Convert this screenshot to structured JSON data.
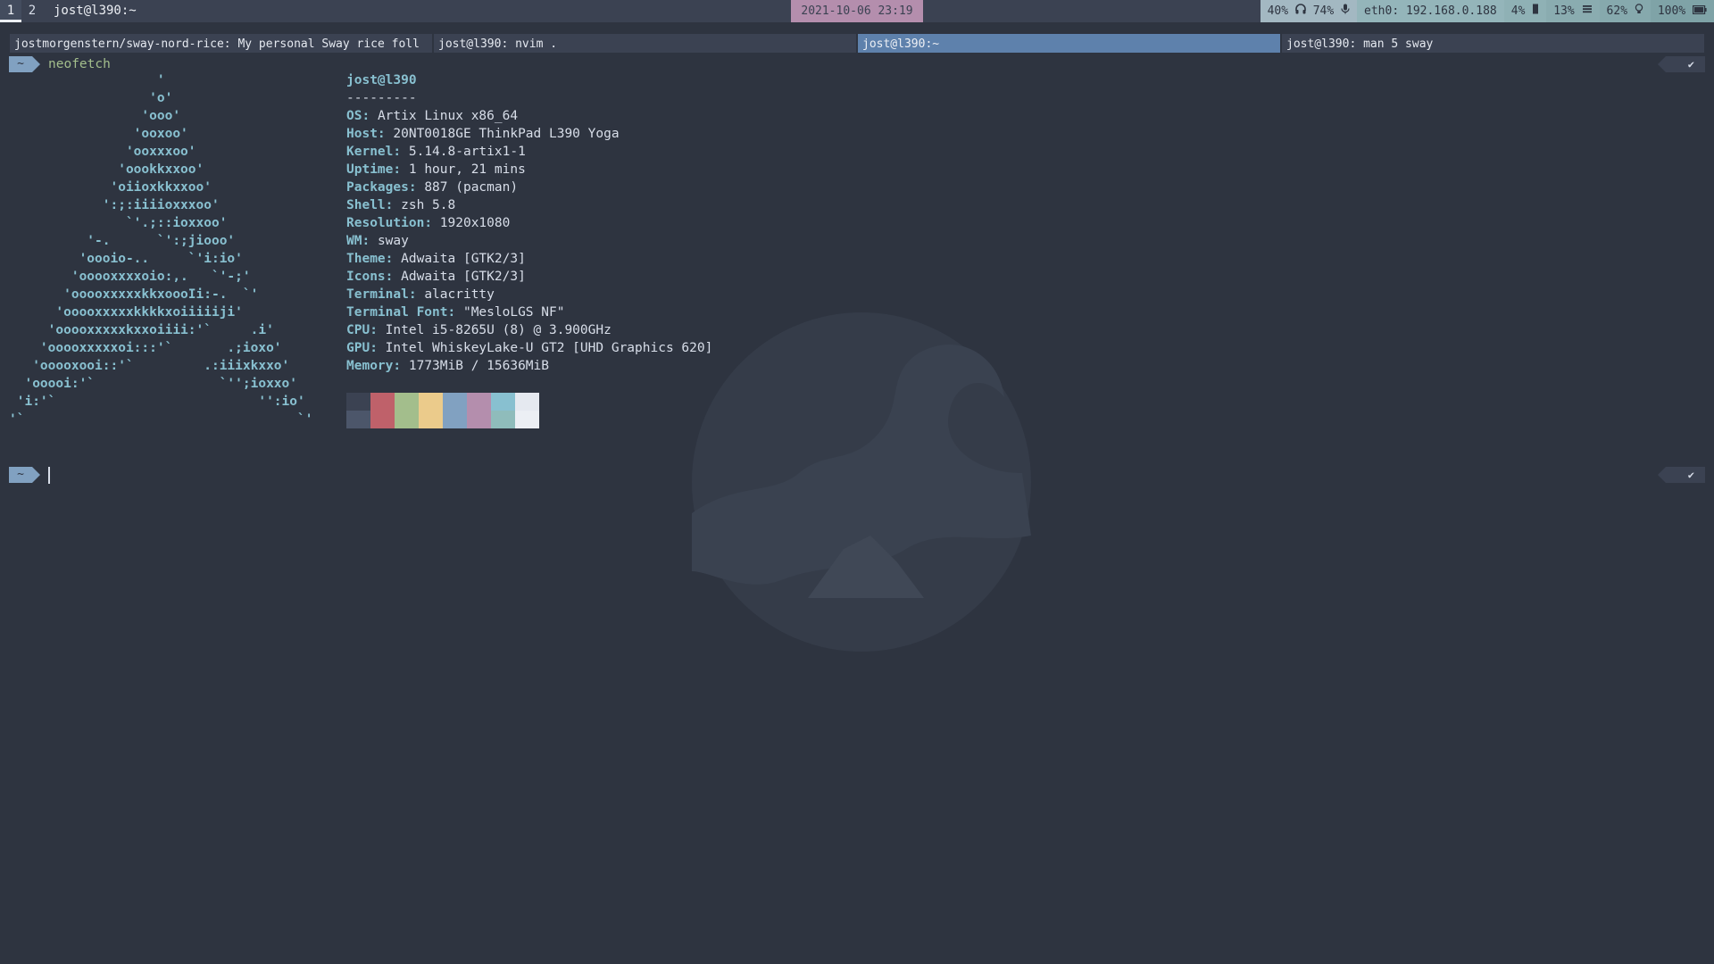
{
  "bar": {
    "workspaces": [
      {
        "label": "1",
        "active": true
      },
      {
        "label": "2",
        "active": false
      }
    ],
    "window_title": "jost@l390:~",
    "clock": "2021-10-06 23:19",
    "audio": "40%",
    "headphone": "74%",
    "network": "eth0: 192.168.0.188",
    "cpu": "4%",
    "memory": "13%",
    "brightness": "62%",
    "battery": "100%"
  },
  "tabs": [
    {
      "label": "jostmorgenstern/sway-nord-rice: My personal Sway rice foll",
      "focused": false
    },
    {
      "label": "jost@l390: nvim .",
      "focused": false
    },
    {
      "label": "jost@l390:~",
      "focused": true
    },
    {
      "label": "jost@l390: man 5 sway",
      "focused": false
    }
  ],
  "terminal": {
    "prompt_dir": "~",
    "command": "neofetch",
    "rprompt": "✔",
    "ascii_logo": "                   '\n                  'o'\n                 'ooo'\n                'ooxoo'\n               'ooxxxoo'\n              'oookkxxoo'\n             'oiioxkkxxoo'\n            ':;:iiiioxxxoo'\n               `'.;::ioxxoo'\n          '-.      `':;jiooo'\n         'oooio-..     `'i:io'\n        'ooooxxxxoio:,.   `'-;'\n       'ooooxxxxxkkxoooIi:-.  `'\n      'ooooxxxxxkkkkxoiiiiiji'\n     'ooooxxxxxkxxoiiii:'`     .i'\n    'ooooxxxxxoi:::'`       .;ioxo'\n   'ooooxooi::'`         .:iiixkxxo'\n  'ooooi:'`                `'';ioxxo'\n 'i:'`                          '':io'\n'`                                   `'",
    "user_host": "jost@l390",
    "separator": "---------",
    "info": [
      {
        "key": "OS",
        "value": "Artix Linux x86_64"
      },
      {
        "key": "Host",
        "value": "20NT0018GE ThinkPad L390 Yoga"
      },
      {
        "key": "Kernel",
        "value": "5.14.8-artix1-1"
      },
      {
        "key": "Uptime",
        "value": "1 hour, 21 mins"
      },
      {
        "key": "Packages",
        "value": "887 (pacman)"
      },
      {
        "key": "Shell",
        "value": "zsh 5.8"
      },
      {
        "key": "Resolution",
        "value": "1920x1080"
      },
      {
        "key": "WM",
        "value": "sway"
      },
      {
        "key": "Theme",
        "value": "Adwaita [GTK2/3]"
      },
      {
        "key": "Icons",
        "value": "Adwaita [GTK2/3]"
      },
      {
        "key": "Terminal",
        "value": "alacritty"
      },
      {
        "key": "Terminal Font",
        "value": "\"MesloLGS NF\""
      },
      {
        "key": "CPU",
        "value": "Intel i5-8265U (8) @ 3.900GHz"
      },
      {
        "key": "GPU",
        "value": "Intel WhiskeyLake-U GT2 [UHD Graphics 620]"
      },
      {
        "key": "Memory",
        "value": "1773MiB / 15636MiB"
      }
    ],
    "palette_top": [
      "#3b4252",
      "#bf616a",
      "#a3be8c",
      "#ebcb8b",
      "#81a1c1",
      "#b48ead",
      "#88c0d0",
      "#e5e9f0"
    ],
    "palette_bottom": [
      "#4c566a",
      "#bf616a",
      "#a3be8c",
      "#ebcb8b",
      "#81a1c1",
      "#b48ead",
      "#8fbcbb",
      "#eceff4"
    ]
  },
  "icons": {
    "headphone": "headphone-icon",
    "mic": "microphone-icon",
    "cpu": "cpu-icon",
    "memory": "memory-icon",
    "brightness": "lightbulb-icon",
    "battery": "battery-icon"
  }
}
